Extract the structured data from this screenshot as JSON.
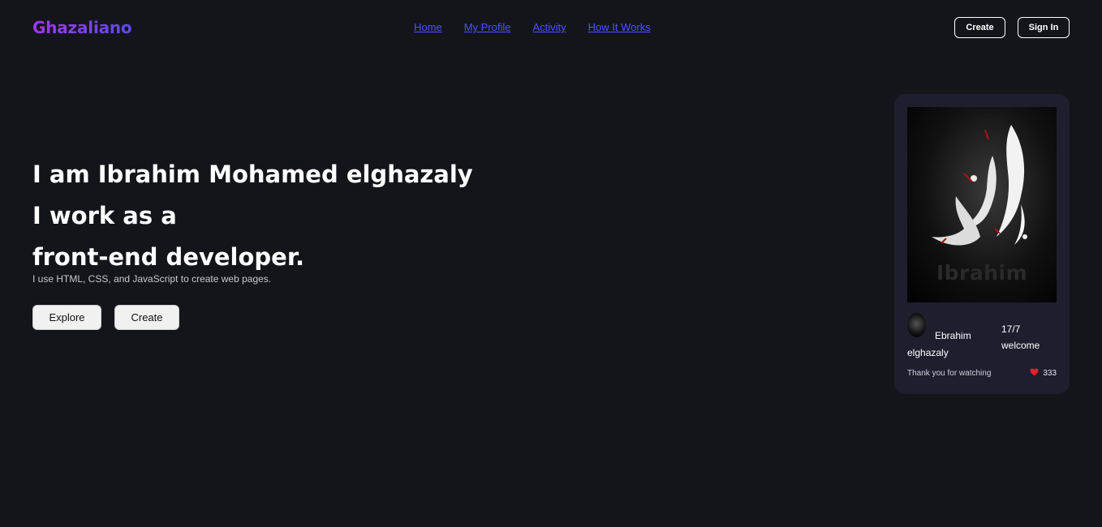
{
  "header": {
    "logo": "Ghazaliano",
    "nav": [
      "Home",
      "My Profile",
      "Activity",
      "How It Works"
    ],
    "create_label": "Create",
    "signin_label": "Sign In"
  },
  "hero": {
    "line1": "I am Ibrahim Mohamed elghazaly",
    "line2": "I work as a",
    "line3": "front-end developer.",
    "subtitle": "I use HTML, CSS, and JavaScript to create web pages.",
    "explore_label": "Explore",
    "create_label": "Create"
  },
  "card": {
    "image_watermark": "Ibrahim",
    "author_first": "Ebrahim",
    "author_last": "elghazaly",
    "date": "17/7",
    "message": "welcome",
    "caption": "Thank you for watching",
    "likes": "333",
    "heart_color": "#e0202e"
  },
  "colors": {
    "background": "#14151b",
    "card": "#1f1e2e",
    "nav_link": "#4a52ff",
    "logo_gradient": [
      "#a335f0",
      "#5a4af0"
    ]
  }
}
